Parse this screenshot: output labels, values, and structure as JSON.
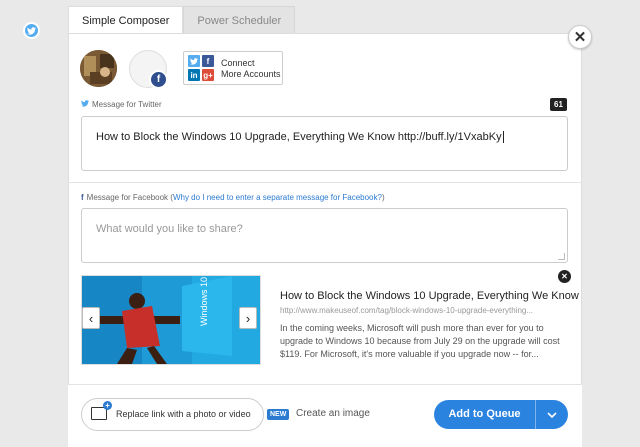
{
  "tabs": [
    {
      "label": "Simple Composer",
      "active": true
    },
    {
      "label": "Power Scheduler",
      "active": false
    }
  ],
  "profiles": {
    "connect_line1": "Connect",
    "connect_line2": "More Accounts",
    "icons": [
      "twitter-icon",
      "facebook-icon",
      "linkedin-icon",
      "google-plus-icon"
    ]
  },
  "twitter": {
    "label": "Message for Twitter",
    "char_count": "61",
    "message": "How to Block the Windows 10 Upgrade, Everything We Know http://buff.ly/1VxabKy"
  },
  "facebook": {
    "label_prefix": "Message for Facebook (",
    "label_link": "Why do I need to enter a separate message for Facebook?",
    "label_suffix": ")",
    "placeholder": "What would you like to share?"
  },
  "link_card": {
    "title": "How to Block the Windows 10 Upgrade, Everything We Know",
    "url": "http://www.makeuseof.com/tag/block-windows-10-upgrade-everything...",
    "description": "In the coming weeks, Microsoft will push more than ever for you to upgrade to Windows 10 because from July 29 on the upgrade will cost $119. For Microsoft, it's more valuable if you upgrade now -- for...",
    "image_text": "Windows 10"
  },
  "footer": {
    "photo_button": "Replace link with a photo or video",
    "new_badge": "NEW",
    "create_image": "Create an image",
    "queue_button": "Add to Queue"
  },
  "colors": {
    "twitter": "#55acee",
    "facebook": "#3b5998",
    "primary": "#2b83e0"
  }
}
